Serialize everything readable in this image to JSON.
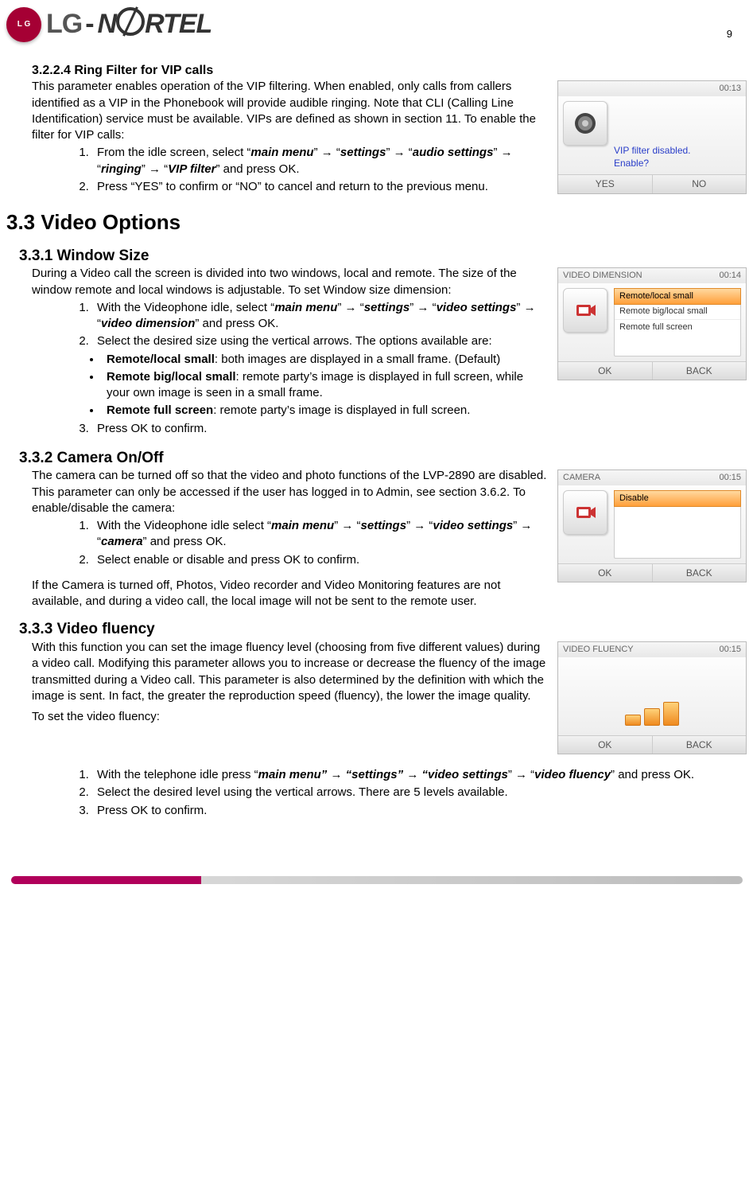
{
  "page_number": "9",
  "logo": {
    "lg": "LG",
    "nortel_pre": "N",
    "nortel_post": "RTEL"
  },
  "s3224": {
    "heading": "3.2.2.4    Ring Filter for VIP calls",
    "p1": "This parameter enables operation of the VIP filtering.  When enabled, only calls from callers identified as a VIP in the Phonebook will provide audible ringing.  Note that CLI (Calling Line Identification) service must be available.  VIPs are defined as shown in section 11. To enable the filter for VIP calls:",
    "step1_a": "From the idle screen, select “",
    "mm": "main menu",
    "arrow": "” → “",
    "settings": "settings",
    "audio": "audio settings",
    "ringing": "ringing",
    "vipfilter": "VIP filter",
    "step1_b": "” and press OK.",
    "step2": "Press “YES” to confirm or “NO” to cancel and return to the previous menu.",
    "box": {
      "time": "00:13",
      "msg1": "VIP filter disabled.",
      "msg2": "Enable?",
      "left": "YES",
      "right": "NO"
    }
  },
  "s33": {
    "heading": "3.3    Video Options"
  },
  "s331": {
    "heading": "3.3.1    Window Size",
    "p1": "During a Video call the screen is divided into two windows, local and remote.  The size of the window remote and local windows is adjustable. To set Window size dimension:",
    "step1_a": "With the Videophone idle, select “",
    "vs": "video settings",
    "vd": "video dimension",
    "step1_b": "” and press OK.",
    "step2": "Select the desired size using the vertical arrows. The options available are:",
    "b1_t": "Remote/local small",
    "b1_d": ": both images are displayed in a small frame. (Default)",
    "b2_t": "Remote big/local small",
    "b2_d": ": remote party’s image is displayed in full screen, while your own image is seen in a small frame.",
    "b3_t": "Remote full screen",
    "b3_d": ": remote party’s image is displayed in full screen.",
    "step3": "Press OK to confirm.",
    "box": {
      "title": "VIDEO DIMENSION",
      "time": "00:14",
      "opt1": "Remote/local small",
      "opt2": "Remote big/local small",
      "opt3": "Remote full screen",
      "left": "OK",
      "right": "BACK"
    }
  },
  "s332": {
    "heading": "3.3.2    Camera On/Off",
    "p1": "The camera can be turned off so that the video and photo functions of the LVP-2890 are disabled.  This parameter can only be accessed if the user has logged in to Admin, see section 3.6.2.  To enable/disable the camera:",
    "step1_a": "With the Videophone idle select “",
    "cam": "camera",
    "step1_b": "” and press OK.",
    "step2": "Select enable or disable and press OK to confirm.",
    "p2": "If the Camera is turned off, Photos, Video recorder and Video Monitoring features are not available, and during a video call, the local image will not be sent to the remote user.",
    "box": {
      "title": "CAMERA",
      "time": "00:15",
      "opt1": "Disable",
      "left": "OK",
      "right": "BACK"
    }
  },
  "s333": {
    "heading": "3.3.3    Video fluency",
    "p1": "With this function you can set the image fluency level (choosing from five different values) during a video call. Modifying this parameter allows you to increase or decrease the fluency of the image transmitted during a Video call. This parameter is also determined by the definition with which the image is sent. In fact, the greater the reproduction speed (fluency), the lower the image quality.",
    "p2": "To set the video fluency:",
    "step1_a": "With the telephone idle press “",
    "mm2": "main menu” → “settings” → “video settings",
    "vf": "video fluency",
    "step1_b": "” and press OK.",
    "step2": "Select the desired level using the vertical arrows. There are 5 levels available.",
    "step3": "Press OK to confirm.",
    "box": {
      "title": "VIDEO FLUENCY",
      "time": "00:15",
      "left": "OK",
      "right": "BACK"
    }
  }
}
